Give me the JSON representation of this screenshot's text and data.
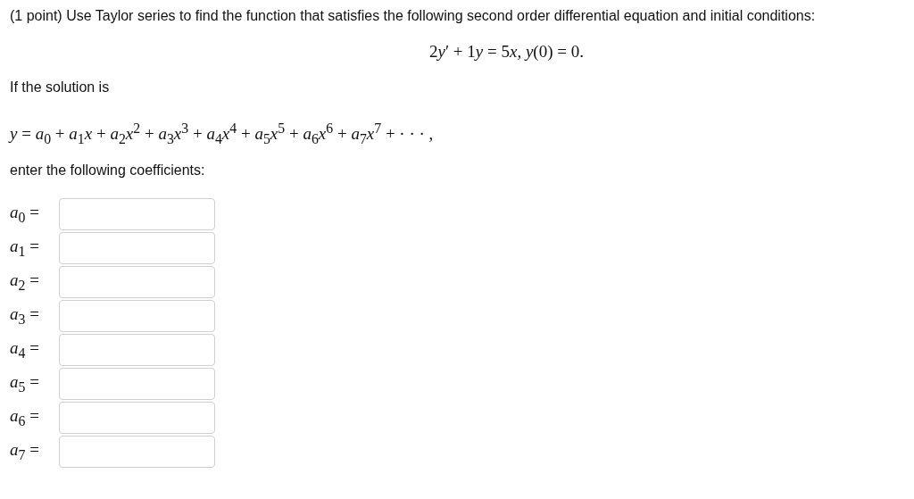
{
  "problem": {
    "statement": "(1 point) Use Taylor series to find the function that satisfies the following second order differential equation and initial conditions:",
    "equation": [
      {
        "kind": "roman",
        "text": "2"
      },
      {
        "kind": "italic",
        "text": "y"
      },
      {
        "kind": "roman",
        "text": "′ + 1"
      },
      {
        "kind": "italic",
        "text": "y"
      },
      {
        "kind": "roman",
        "text": " = 5"
      },
      {
        "kind": "italic",
        "text": "x"
      },
      {
        "kind": "roman",
        "text": ", "
      },
      {
        "kind": "italic",
        "text": "y"
      },
      {
        "kind": "roman",
        "text": "(0) = 0."
      }
    ],
    "solution_intro": "If the solution is",
    "series": "*y* = *a*$_{0}$ + *a*$_{1}$*x* + *a*$_{2}$*x*$^{2}$ + *a*$_{3}$*x*$^{3}$ + *a*$_{4}$*x*$^{4}$ + *a*$_{5}$*x*$^{5}$ + *a*$_{6}$*x*$^{6}$ + *a*$_{7}$*x*$^{7}$ + · · · ,",
    "instruction": "enter the following coefficients:"
  },
  "answers": [
    {
      "label": "*a*$_{0}$ ="
    },
    {
      "label": "*a*$_{1}$ ="
    },
    {
      "label": "*a*$_{2}$ ="
    },
    {
      "label": "*a*$_{3}$ ="
    },
    {
      "label": "*a*$_{4}$ ="
    },
    {
      "label": "*a*$_{5}$ ="
    },
    {
      "label": "*a*$_{6}$ ="
    },
    {
      "label": "*a*$_{7}$ ="
    }
  ]
}
